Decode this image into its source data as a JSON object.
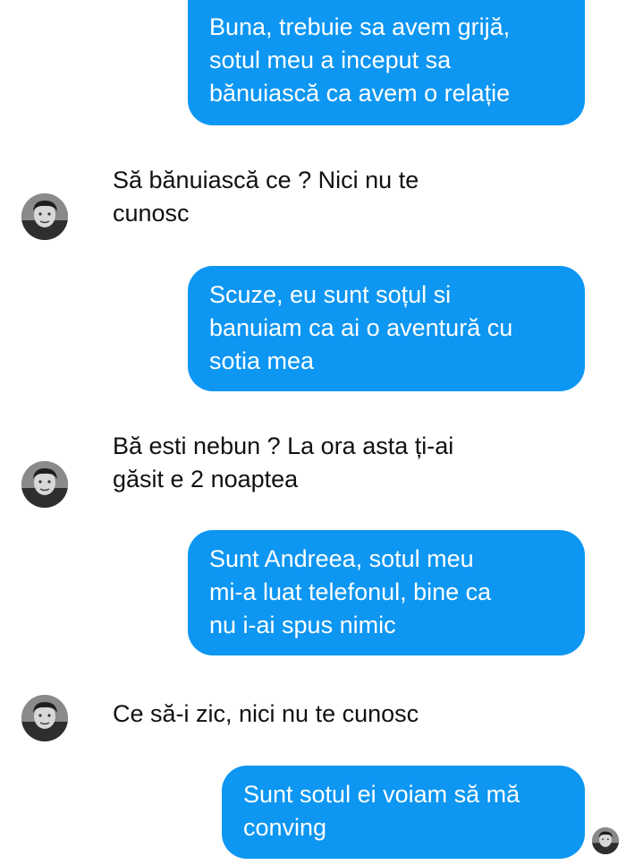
{
  "conversation": {
    "messages": [
      {
        "direction": "outgoing",
        "text": "Buna, trebuie sa avem grijă,\nsotul meu a inceput sa\nbănuiască ca avem o relație"
      },
      {
        "direction": "incoming",
        "text": "Să bănuiască ce ? Nici nu te\ncunosc"
      },
      {
        "direction": "outgoing",
        "text": "Scuze, eu sunt soțul si\nbanuiam ca ai o aventură cu\nsotia mea"
      },
      {
        "direction": "incoming",
        "text": "Bă esti nebun ? La ora asta ți-ai\ngăsit e 2 noaptea"
      },
      {
        "direction": "outgoing",
        "text": "Sunt Andreea, sotul meu\nmi-a luat telefonul, bine ca\nnu i-ai spus nimic"
      },
      {
        "direction": "incoming",
        "text": "Ce să-i zic, nici nu te cunosc"
      },
      {
        "direction": "outgoing",
        "text": "Sunt sotul ei voiam să mă\nconving"
      }
    ]
  },
  "colors": {
    "outgoing_bubble": "#0d96f2",
    "outgoing_text": "#ffffff",
    "incoming_text": "#111111",
    "background": "#ffffff"
  },
  "icons": {
    "avatar": "contact-avatar-photo",
    "read_receipt": "seen-avatar"
  }
}
